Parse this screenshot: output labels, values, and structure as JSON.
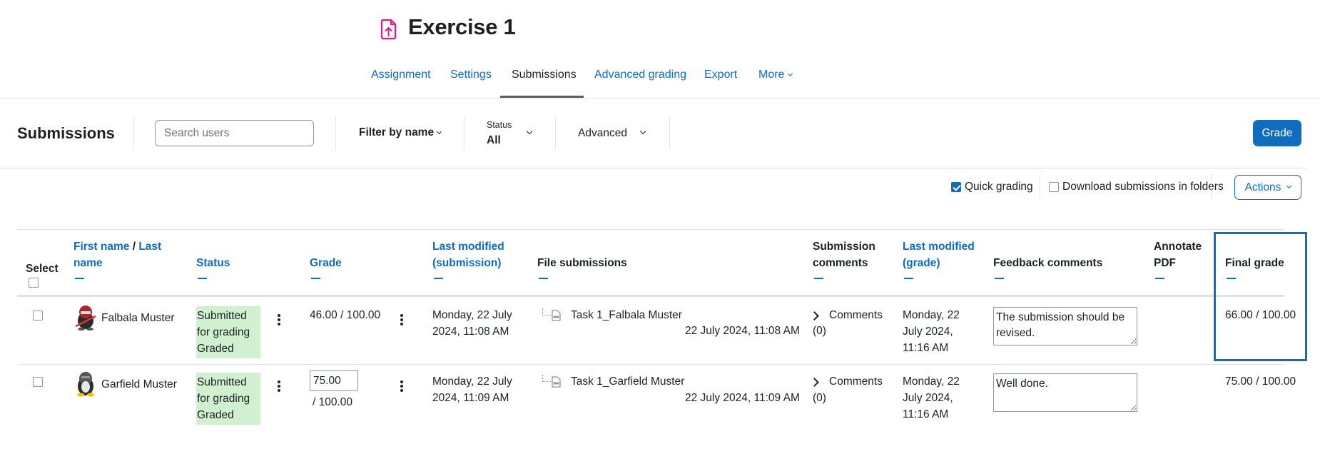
{
  "header": {
    "title": "Exercise 1",
    "title_icon": "assignment-upload-icon",
    "icon_color": "#e6168b"
  },
  "nav": {
    "tabs": [
      {
        "label": "Assignment",
        "active": false
      },
      {
        "label": "Settings",
        "active": false
      },
      {
        "label": "Submissions",
        "active": true
      },
      {
        "label": "Advanced grading",
        "active": false
      },
      {
        "label": "Export",
        "active": false
      },
      {
        "label": "More",
        "active": false
      }
    ]
  },
  "toolbar": {
    "heading": "Submissions",
    "search_placeholder": "Search users",
    "filter_by_name": "Filter by name",
    "status_label": "Status",
    "status_value": "All",
    "advanced_label": "Advanced",
    "grade_button": "Grade"
  },
  "options": {
    "quick_grading_label": "Quick grading",
    "quick_grading_checked": true,
    "download_folders_label": "Download submissions in folders",
    "download_folders_checked": false,
    "actions_label": "Actions"
  },
  "table": {
    "headers": {
      "select": "Select",
      "first_name": "First name",
      "name_separator": " / ",
      "last_name_1": "Last",
      "last_name_2": "name",
      "status": "Status",
      "grade": "Grade",
      "last_modified_submission_1": "Last modified",
      "last_modified_submission_2": "(submission)",
      "file_submissions": "File submissions",
      "submission_comments_1": "Submission",
      "submission_comments_2": "comments",
      "last_modified_grade_1": "Last modified",
      "last_modified_grade_2": "(grade)",
      "feedback_comments": "Feedback comments",
      "annotate_pdf_1": "Annotate",
      "annotate_pdf_2": "PDF",
      "final_grade": "Final grade"
    },
    "rows": [
      {
        "name": "Falbala Muster",
        "avatar": "red-penguin-avatar",
        "status_1": "Submitted",
        "status_2": "for grading",
        "status_3": "Graded",
        "grade": "46.00 / 100.00",
        "grade_editable": false,
        "last_modified_1": "Monday, 22 July",
        "last_modified_2": "2024, 11:08 AM",
        "file_name": "Task 1_Falbala Muster",
        "file_date": "22 July 2024, 11:08 AM",
        "comments_label": "Comments",
        "comments_count": "(0)",
        "grade_modified_1": "Monday, 22",
        "grade_modified_2": "July 2024,",
        "grade_modified_3": "11:16 AM",
        "feedback": "The submission should be revised.",
        "final_grade": "66.00 / 100.00"
      },
      {
        "name": "Garfield Muster",
        "avatar": "grey-penguin-avatar",
        "status_1": "Submitted",
        "status_2": "for grading",
        "status_3": "Graded",
        "grade_value": "75.00",
        "grade_max": "/ 100.00",
        "grade_editable": true,
        "last_modified_1": "Monday, 22 July",
        "last_modified_2": "2024, 11:09 AM",
        "file_name": "Task 1_Garfield Muster",
        "file_date": "22 July 2024, 11:09 AM",
        "comments_label": "Comments",
        "comments_count": "(0)",
        "grade_modified_1": "Monday, 22",
        "grade_modified_2": "July 2024,",
        "grade_modified_3": "11:16 AM",
        "feedback": "Well done.",
        "final_grade": "75.00 / 100.00"
      }
    ]
  },
  "colors": {
    "accent": "#0f6cbf",
    "status_graded_bg": "#d1f0cf",
    "title_icon": "#e6168b"
  }
}
